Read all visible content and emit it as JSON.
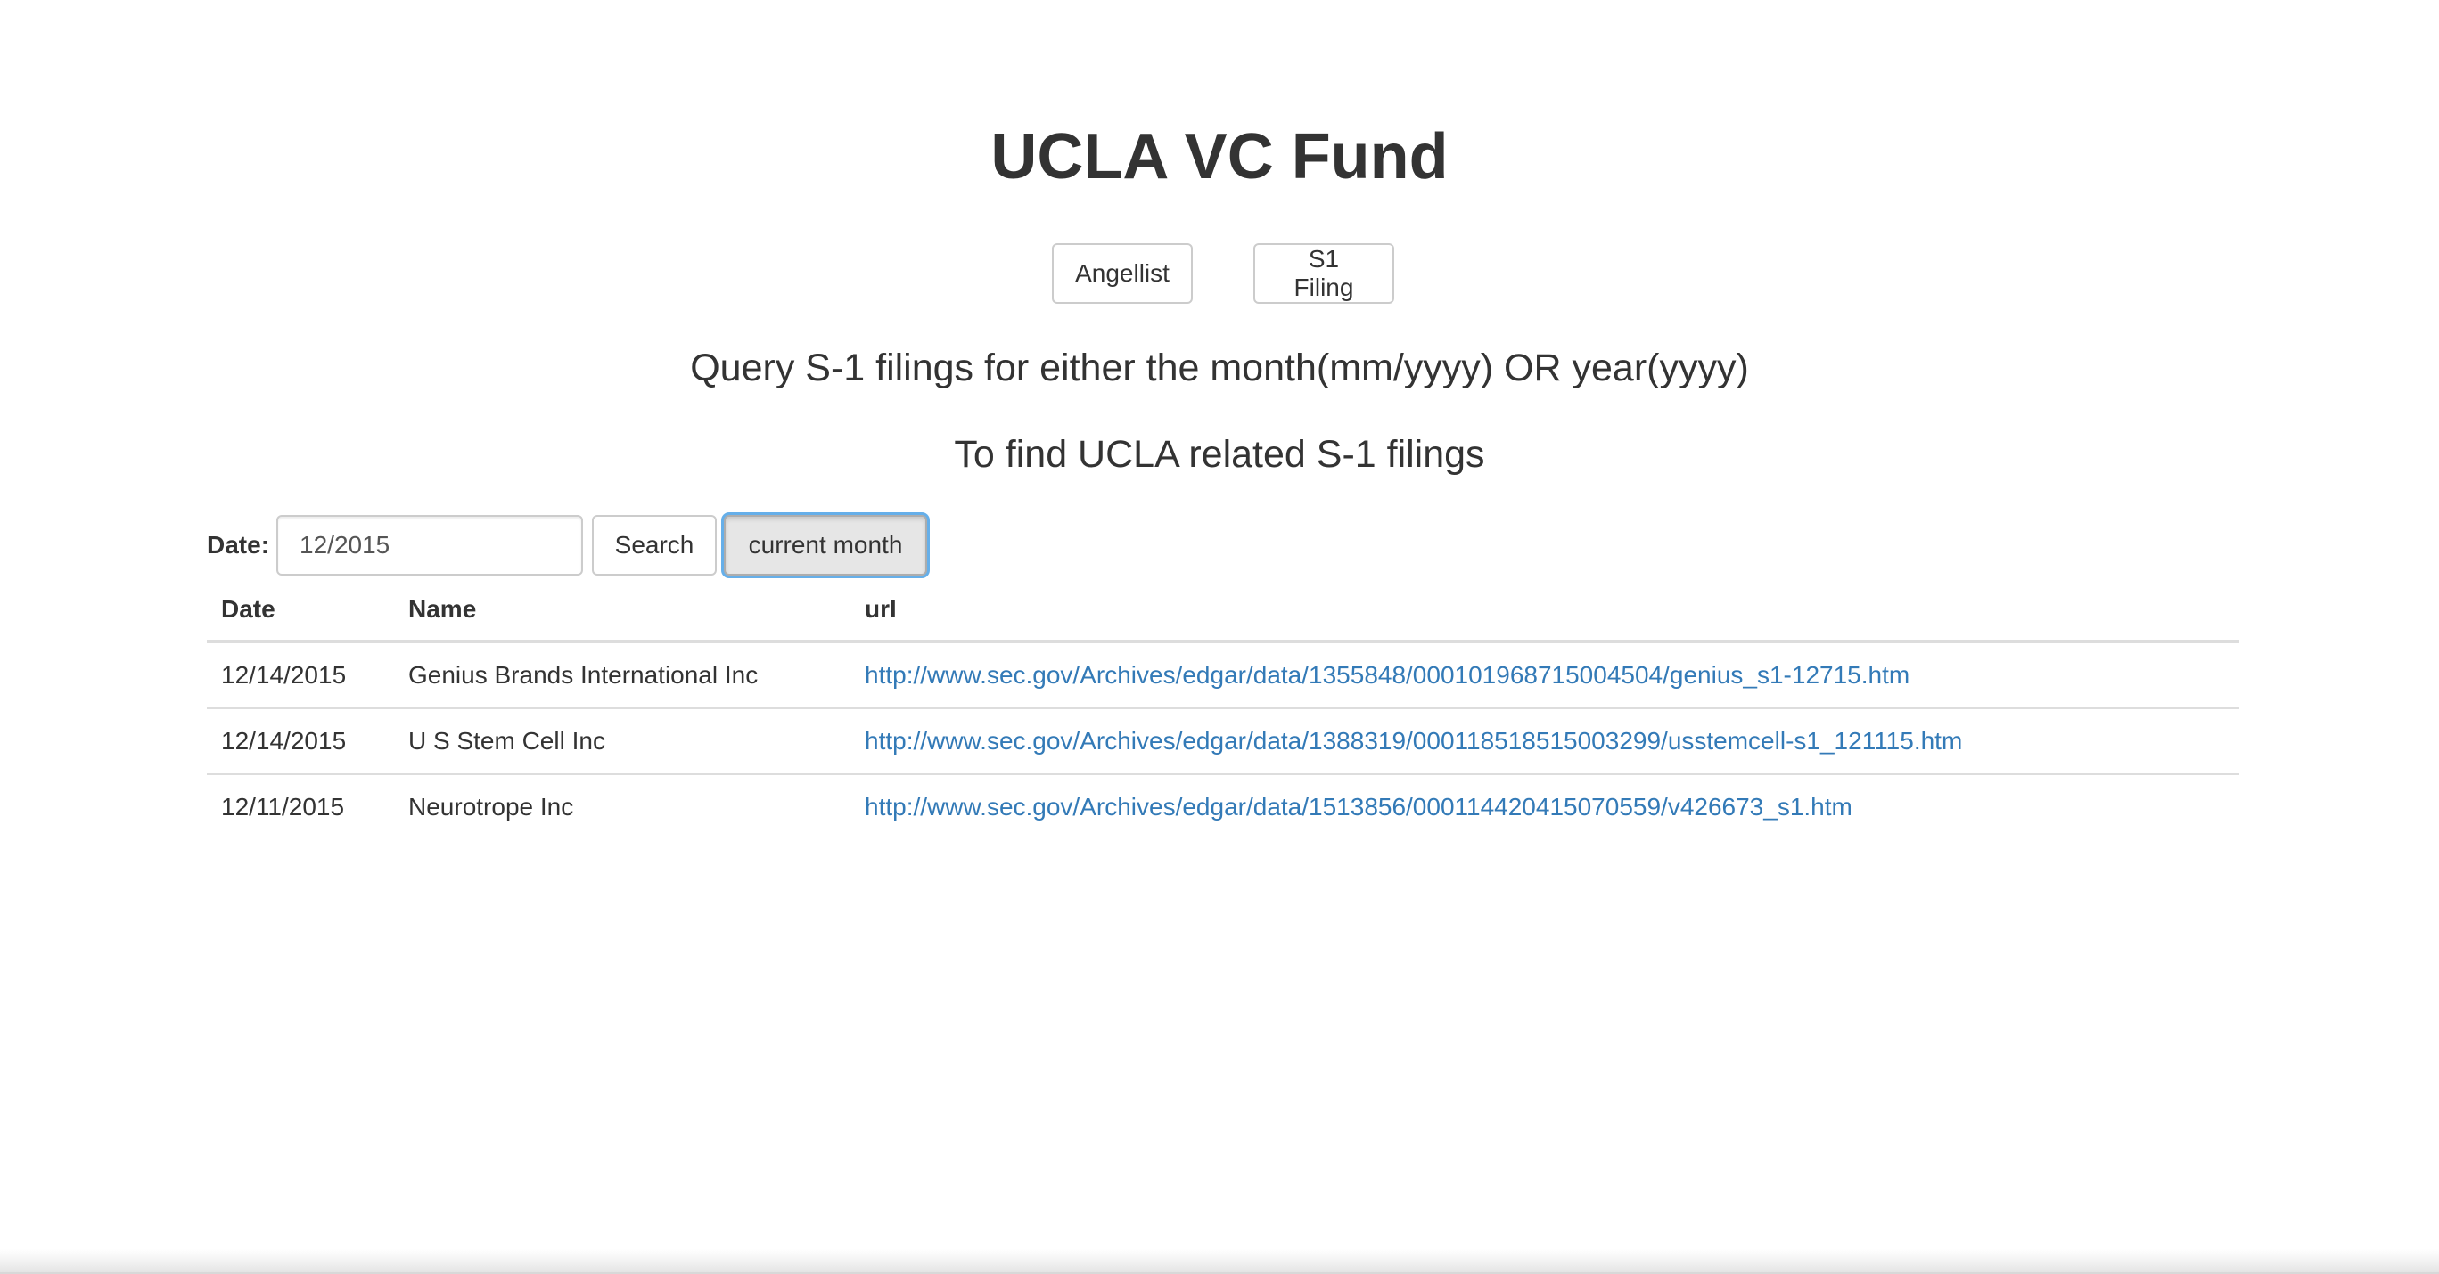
{
  "title": "UCLA VC Fund",
  "nav": {
    "angellist_label": "Angellist",
    "s1_label": "S1 Filing"
  },
  "subtitle_1": "Query S-1 filings for either the month(mm/yyyy) OR year(yyyy)",
  "subtitle_2": "To find UCLA related S-1 filings",
  "search": {
    "label": "Date:",
    "value": "12/2015",
    "search_label": "Search",
    "current_month_label": "current month"
  },
  "table": {
    "headers": {
      "date": "Date",
      "name": "Name",
      "url": "url"
    },
    "rows": [
      {
        "date": "12/14/2015",
        "name": "Genius Brands International Inc",
        "url": "http://www.sec.gov/Archives/edgar/data/1355848/000101968715004504/genius_s1-12715.htm"
      },
      {
        "date": "12/14/2015",
        "name": "U S Stem Cell Inc",
        "url": "http://www.sec.gov/Archives/edgar/data/1388319/000118518515003299/usstemcell-s1_121115.htm"
      },
      {
        "date": "12/11/2015",
        "name": "Neurotrope Inc",
        "url": "http://www.sec.gov/Archives/edgar/data/1513856/000114420415070559/v426673_s1.htm"
      }
    ]
  },
  "colors": {
    "text": "#333333",
    "link": "#337ab7",
    "focus_ring": "#66afe9",
    "border": "#cccccc"
  }
}
